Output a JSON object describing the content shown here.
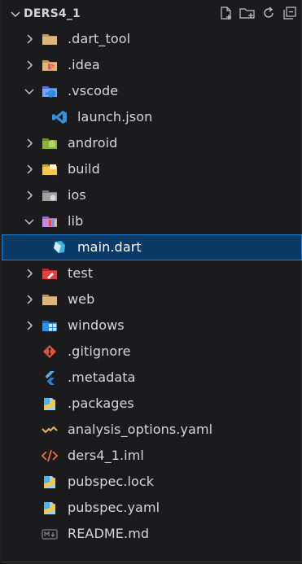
{
  "explorer": {
    "root_label": "DERS4_1",
    "actions": [
      {
        "name": "new-file-icon"
      },
      {
        "name": "new-folder-icon"
      },
      {
        "name": "refresh-icon"
      },
      {
        "name": "collapse-all-icon"
      }
    ]
  },
  "tree": [
    {
      "label": ".dart_tool",
      "type": "folder",
      "expanded": false,
      "depth": 0,
      "icon": "folder-icon"
    },
    {
      "label": ".idea",
      "type": "folder",
      "expanded": false,
      "depth": 0,
      "icon": "idea-folder-icon"
    },
    {
      "label": ".vscode",
      "type": "folder",
      "expanded": true,
      "depth": 0,
      "icon": "vscode-folder-icon"
    },
    {
      "label": "launch.json",
      "type": "file",
      "depth": 1,
      "icon": "vscode-file-icon"
    },
    {
      "label": "android",
      "type": "folder",
      "expanded": false,
      "depth": 0,
      "icon": "android-folder-icon"
    },
    {
      "label": "build",
      "type": "folder",
      "expanded": false,
      "depth": 0,
      "icon": "build-folder-icon"
    },
    {
      "label": "ios",
      "type": "folder",
      "expanded": false,
      "depth": 0,
      "icon": "ios-folder-icon"
    },
    {
      "label": "lib",
      "type": "folder",
      "expanded": true,
      "depth": 0,
      "icon": "lib-folder-icon"
    },
    {
      "label": "main.dart",
      "type": "file",
      "depth": 1,
      "icon": "dart-file-icon",
      "selected": true
    },
    {
      "label": "test",
      "type": "folder",
      "expanded": false,
      "depth": 0,
      "icon": "test-folder-icon"
    },
    {
      "label": "web",
      "type": "folder",
      "expanded": false,
      "depth": 0,
      "icon": "folder-icon"
    },
    {
      "label": "windows",
      "type": "folder",
      "expanded": false,
      "depth": 0,
      "icon": "windows-folder-icon"
    },
    {
      "label": ".gitignore",
      "type": "file",
      "depth": 0,
      "icon": "git-file-icon"
    },
    {
      "label": ".metadata",
      "type": "file",
      "depth": 0,
      "icon": "flutter-file-icon"
    },
    {
      "label": ".packages",
      "type": "file",
      "depth": 0,
      "icon": "package-file-icon"
    },
    {
      "label": "analysis_options.yaml",
      "type": "file",
      "depth": 0,
      "icon": "yaml-file-icon"
    },
    {
      "label": "ders4_1.iml",
      "type": "file",
      "depth": 0,
      "icon": "xml-file-icon"
    },
    {
      "label": "pubspec.lock",
      "type": "file",
      "depth": 0,
      "icon": "package-file-icon"
    },
    {
      "label": "pubspec.yaml",
      "type": "file",
      "depth": 0,
      "icon": "package-file-icon"
    },
    {
      "label": "README.md",
      "type": "file",
      "depth": 0,
      "icon": "markdown-file-icon"
    }
  ],
  "colors": {
    "background": "#1b1b1d",
    "selection": "#0b3a66",
    "selection_border": "#1b7fd4",
    "text": "#d7d7d7"
  }
}
